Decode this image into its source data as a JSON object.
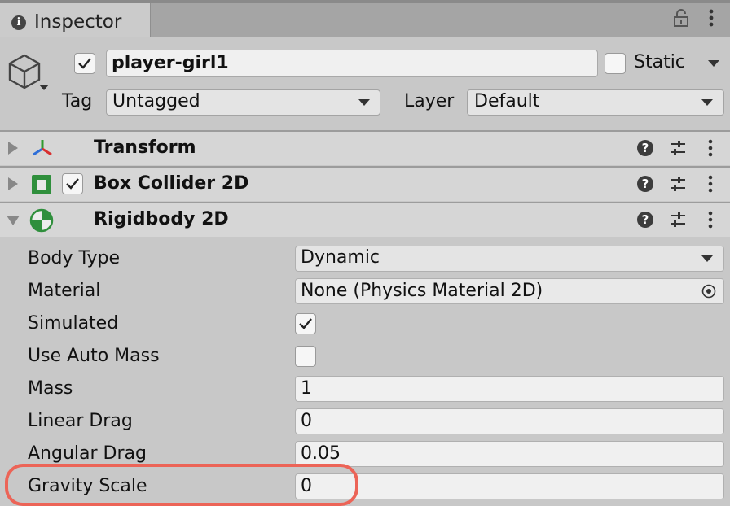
{
  "tab": {
    "title": "Inspector"
  },
  "gameobject": {
    "name": "player-girl1",
    "active": true,
    "static_label": "Static",
    "static": false,
    "tag_label": "Tag",
    "tag_value": "Untagged",
    "layer_label": "Layer",
    "layer_value": "Default"
  },
  "components": [
    {
      "title": "Transform",
      "expanded": false
    },
    {
      "title": "Box Collider 2D",
      "expanded": false,
      "enabled": true
    },
    {
      "title": "Rigidbody 2D",
      "expanded": true
    }
  ],
  "help_glyph": "?",
  "rigidbody": {
    "body_type": {
      "label": "Body Type",
      "value": "Dynamic"
    },
    "material": {
      "label": "Material",
      "value": "None (Physics Material 2D)"
    },
    "simulated": {
      "label": "Simulated",
      "checked": true
    },
    "use_auto_mass": {
      "label": "Use Auto Mass",
      "checked": false
    },
    "mass": {
      "label": "Mass",
      "value": "1"
    },
    "linear_drag": {
      "label": "Linear Drag",
      "value": "0"
    },
    "angular_drag": {
      "label": "Angular Drag",
      "value": "0.05"
    },
    "gravity_scale": {
      "label": "Gravity Scale",
      "value": "0"
    }
  },
  "colors": {
    "highlight": "#ec6457",
    "panel_bg": "#c8c8c8",
    "header_bg": "#d6d6d6"
  },
  "icons": {
    "tab": "info-icon",
    "lock": "lock-icon",
    "gameobject": "cube-icon",
    "transform": "transform-axes-icon",
    "box_collider": "box-collider-icon",
    "rigidbody": "rigidbody-icon",
    "help": "help-icon",
    "presets": "sliders-icon",
    "menu": "kebab-menu-icon",
    "object_picker": "object-picker-icon"
  }
}
